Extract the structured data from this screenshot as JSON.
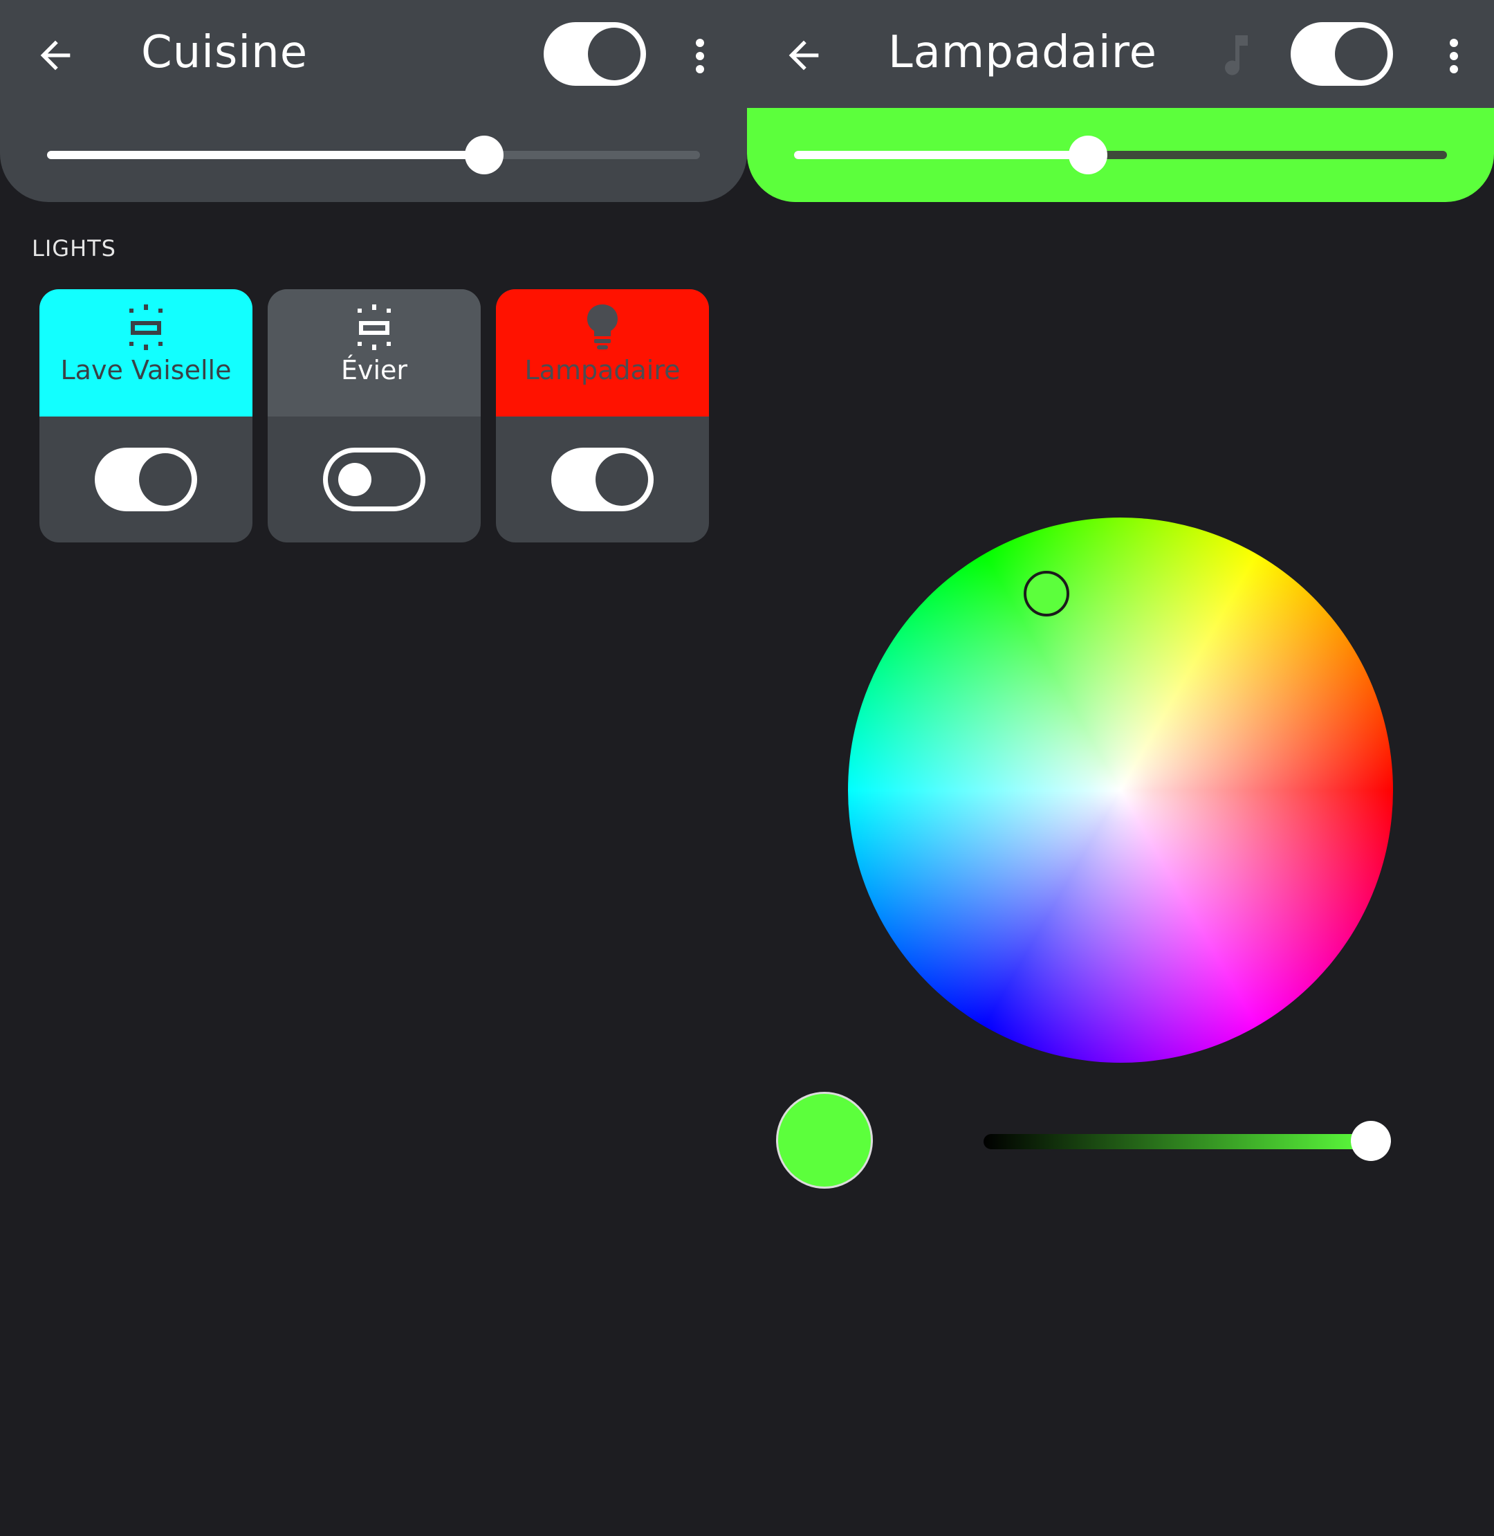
{
  "colors": {
    "background": "#1d1d21",
    "bar": "#41454a",
    "green": "#5cff3c",
    "cyan": "#12ffff",
    "red": "#ff1200",
    "card_grey": "#52575c"
  },
  "left_panel": {
    "back_icon": "arrow-left-icon",
    "title": "Cuisine",
    "group_switch_on": true,
    "menu_icon": "more-vert-icon",
    "brightness": 0.67,
    "section_label": "LIGHTS",
    "lights": [
      {
        "name": "Lave Vaiselle",
        "icon": "light-strip-icon",
        "on": true,
        "color": "#12ffff",
        "text_color": "#3b4146"
      },
      {
        "name": "Évier",
        "icon": "light-strip-icon",
        "on": false,
        "color": "#52575c",
        "text_color": "#ffffff"
      },
      {
        "name": "Lampadaire",
        "icon": "bulb-icon",
        "on": true,
        "color": "#ff1200",
        "text_color": "#4a4d52"
      }
    ]
  },
  "right_panel": {
    "back_icon": "arrow-left-icon",
    "title": "Lampadaire",
    "music_icon": "music-note-icon",
    "switch_on": true,
    "menu_icon": "more-vert-icon",
    "brightness": 0.45,
    "selected_color": "#5cff3c",
    "saturation": 1.0
  }
}
